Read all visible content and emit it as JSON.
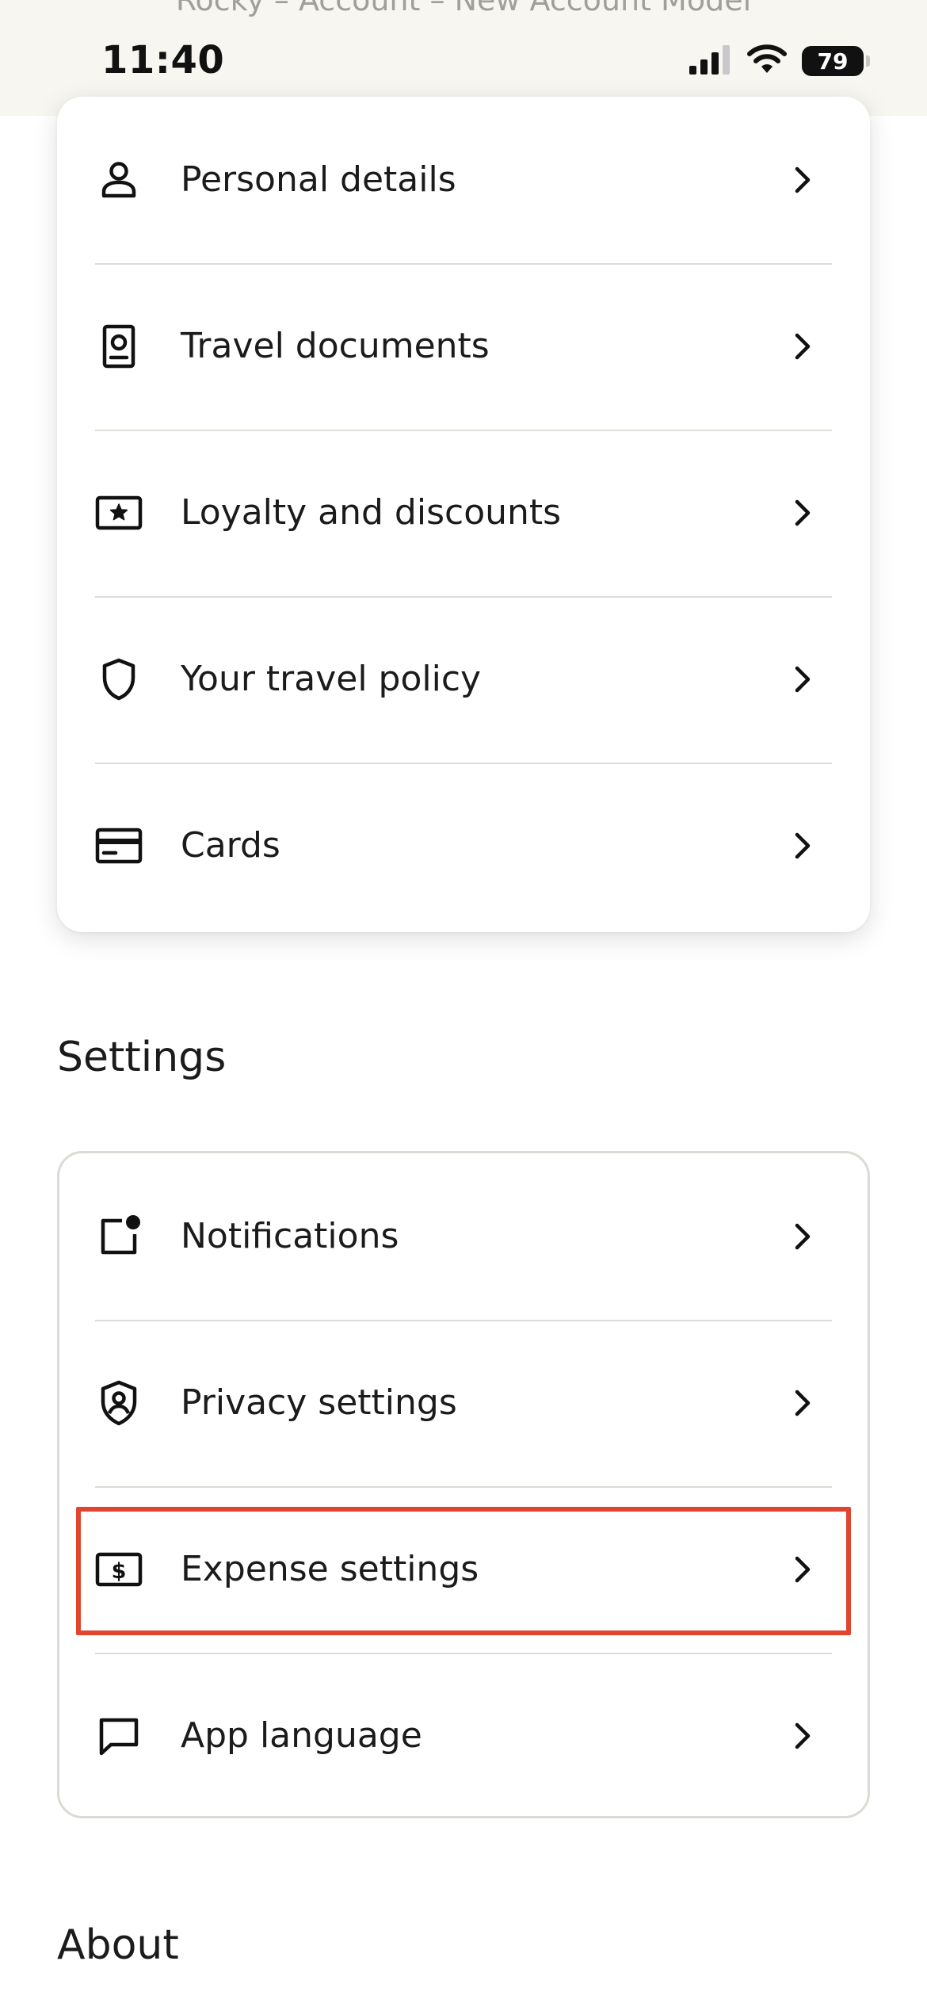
{
  "status_bar": {
    "breadcrumb": "Rocky – Account – New Account Model",
    "time": "11:40",
    "battery": "79",
    "icons": [
      "cellular-signal-icon",
      "wifi-icon",
      "battery-icon"
    ]
  },
  "profile_menu": {
    "items": [
      {
        "label": "Personal details",
        "icon": "person-icon"
      },
      {
        "label": "Travel documents",
        "icon": "passport-icon"
      },
      {
        "label": "Loyalty and discounts",
        "icon": "star-ticket-icon"
      },
      {
        "label": "Your travel policy",
        "icon": "shield-icon"
      },
      {
        "label": "Cards",
        "icon": "credit-card-icon"
      }
    ]
  },
  "settings": {
    "title": "Settings",
    "items": [
      {
        "label": "Notifications",
        "icon": "notification-icon"
      },
      {
        "label": "Privacy settings",
        "icon": "privacy-shield-icon"
      },
      {
        "label": "Expense settings",
        "icon": "dollar-bill-icon",
        "highlighted": true
      },
      {
        "label": "App language",
        "icon": "chat-bubble-icon"
      }
    ]
  },
  "about": {
    "title": "About"
  },
  "colors": {
    "status_bar_bg": "#f7f6f1",
    "text": "#1b1b1b",
    "divider": "#dedcd6",
    "highlight": "#e1442f"
  }
}
